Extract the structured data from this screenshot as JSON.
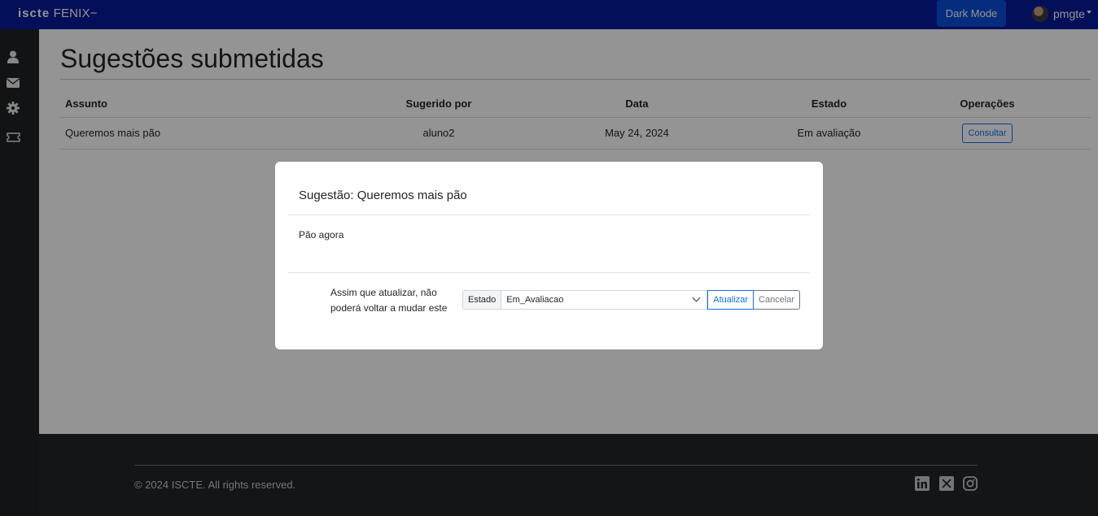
{
  "navbar": {
    "brand_logo": "iscte",
    "brand_name": "FENIX",
    "dark_mode_label": "Dark Mode",
    "username": "pmgte"
  },
  "sidebar": {
    "icons": [
      "user-icon",
      "envelope-icon",
      "gear-icon",
      "ticket-icon"
    ]
  },
  "page": {
    "title": "Sugestões submetidas"
  },
  "table": {
    "headers": [
      "Assunto",
      "Sugerido por",
      "Data",
      "Estado",
      "Operações"
    ],
    "rows": [
      {
        "assunto": "Queremos mais pão",
        "sugerido_por": "aluno2",
        "data": "May 24, 2024",
        "estado": "Em avaliação",
        "operacao": "Consultar"
      }
    ]
  },
  "modal": {
    "title": "Sugestão: Queremos mais pão",
    "body": "Pão agora",
    "warning": "Assim que atualizar, não poderá voltar a mudar este",
    "estado_label": "Estado",
    "estado_value": "Em_Avaliacao",
    "update_label": "Atualizar",
    "cancel_label": "Cancelar"
  },
  "footer": {
    "copyright": "© 2024 ISCTE. All rights reserved.",
    "social": [
      "linkedin-icon",
      "x-icon",
      "instagram-icon"
    ]
  },
  "colors": {
    "navbar": "#081a9a",
    "dark_mode_button": "#0b4fd8",
    "primary": "#0d6efd",
    "sidebar": "#1f2124",
    "footer": "#212529"
  }
}
